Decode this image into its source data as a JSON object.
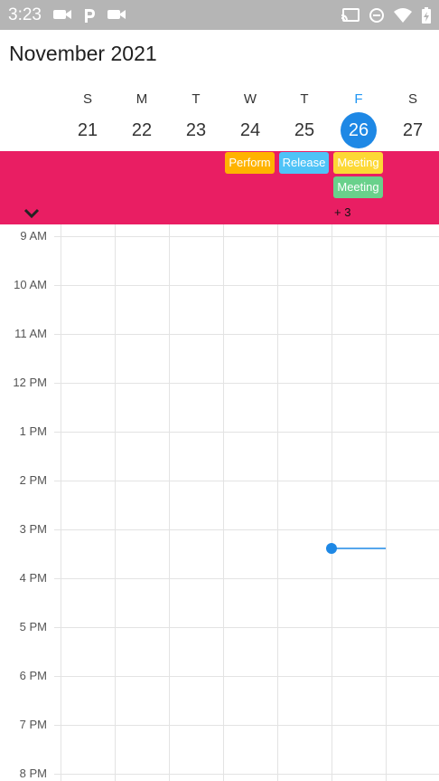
{
  "status_bar": {
    "time": "3:23",
    "left_icons": [
      "video-camera-icon",
      "parking-icon",
      "video-camera-icon"
    ],
    "right_icons": [
      "cast-icon",
      "do-not-disturb-icon",
      "wifi-icon",
      "battery-charging-icon"
    ]
  },
  "header": {
    "title": "November 2021"
  },
  "week": {
    "days": [
      {
        "letter": "S",
        "num": "21"
      },
      {
        "letter": "M",
        "num": "22"
      },
      {
        "letter": "T",
        "num": "23"
      },
      {
        "letter": "W",
        "num": "24"
      },
      {
        "letter": "T",
        "num": "25"
      },
      {
        "letter": "F",
        "num": "26",
        "today": true
      },
      {
        "letter": "S",
        "num": "27"
      }
    ]
  },
  "allday": {
    "background": "#e91e63",
    "events": [
      {
        "label": "Perform",
        "color": "#ffb300"
      },
      {
        "label": "Release",
        "color": "#4fc3f7"
      },
      {
        "label": "Meeting",
        "color": "#fdd835"
      },
      {
        "label": "Meeting",
        "color": "#69d18b"
      }
    ],
    "more_label": "+ 3",
    "expand_icon": "chevron-down-icon"
  },
  "timeline": {
    "labels": [
      "9 AM",
      "10 AM",
      "11 AM",
      "12 PM",
      "1 PM",
      "2 PM",
      "3 PM",
      "4 PM",
      "5 PM",
      "6 PM",
      "7 PM",
      "8 PM"
    ],
    "current_time_color": "#1e88e5"
  }
}
